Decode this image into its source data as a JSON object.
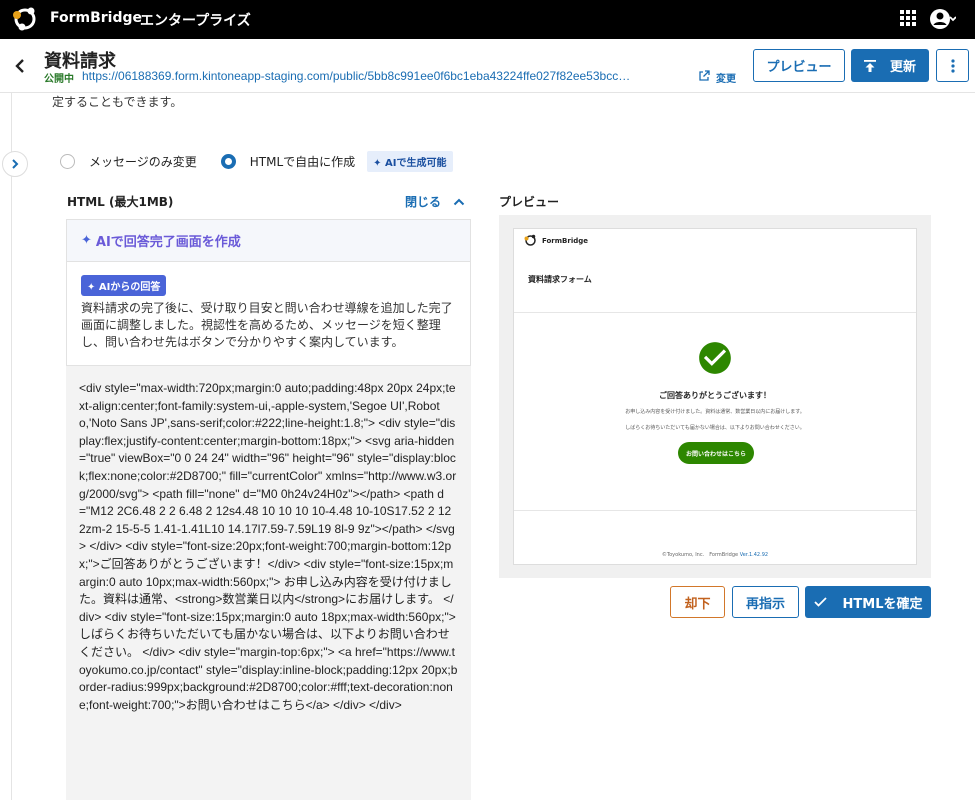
{
  "topbar": {
    "brand": "FormBridge",
    "edition": "エンタープライズ",
    "icons": [
      "logo-icon",
      "apps-grid-icon",
      "user-account-icon"
    ]
  },
  "header": {
    "title": "資料請求",
    "status": "公開中",
    "url": "https://06188369.form.kintoneapp-staging.com/public/5bb8c991ee0f6bc1eba43224ffe027f82ee53bcc…",
    "change": "変更",
    "preview_button": "プレビュー",
    "update_button": "更新"
  },
  "intro_text": "定することもできます。",
  "mode": {
    "option_message": "メッセージのみ変更",
    "option_html": "HTMLで自由に作成",
    "selected": "html",
    "ai_badge": "AIで生成可能"
  },
  "editor": {
    "label": "HTML (最大1MB)",
    "close": "閉じる",
    "ai_header": "AIで回答完了画面を作成",
    "ai_answer_badge": "AIからの回答",
    "ai_answer": "資料請求の完了後に、受け取り目安と問い合わせ導線を追加した完了画面に調整しました。視認性を高めるため、メッセージを短く整理し、問い合わせ先はボタンで分かりやすく案内しています。",
    "code": "<div style=\"max-width:720px;margin:0 auto;padding:48px 20px 24px;text-align:center;font-family:system-ui,-apple-system,'Segoe UI',Roboto,'Noto Sans JP',sans-serif;color:#222;line-height:1.8;\"> <div style=\"display:flex;justify-content:center;margin-bottom:18px;\"> <svg aria-hidden=\"true\" viewBox=\"0 0 24 24\" width=\"96\" height=\"96\" style=\"display:block;flex:none;color:#2D8700;\" fill=\"currentColor\" xmlns=\"http://www.w3.org/2000/svg\"> <path fill=\"none\" d=\"M0 0h24v24H0z\"></path> <path d=\"M12 2C6.48 2 2 6.48 2 12s4.48 10 10 10 10-4.48 10-10S17.52 2 12 2zm-2 15-5-5 1.41-1.41L10 14.17l7.59-7.59L19 8l-9 9z\"></path> </svg> </div> <div style=\"font-size:20px;font-weight:700;margin-bottom:12px;\">ご回答ありがとうございます！</div> <div style=\"font-size:15px;margin:0 auto 10px;max-width:560px;\"> お申し込み内容を受け付けました。資料は通常、<strong>数営業日以内</strong>にお届けします。 </div> <div style=\"font-size:15px;margin:0 auto 18px;max-width:560px;\"> しばらくお待ちいただいても届かない場合は、以下よりお問い合わせください。 </div> <div style=\"margin-top:6px;\"> <a href=\"https://www.toyokumo.co.jp/contact\" style=\"display:inline-block;padding:12px 20px;border-radius:999px;background:#2D8700;color:#fff;text-decoration:none;font-weight:700;\">お問い合わせはこちら</a> </div> </div>"
  },
  "preview": {
    "label": "プレビュー",
    "brand": "FormBridge",
    "form_title": "資料請求フォーム",
    "thanks": "ご回答ありがとうございます！",
    "line1": "お申し込み内容を受け付けました。資料は通常、数営業日以内にお届けします。",
    "line2": "しばらくお待ちいただいても届かない場合は、以下よりお問い合わせください。",
    "contact_button": "お問い合わせはこちら",
    "footer": "©Toyokumo, Inc.　FormBridge",
    "version": "Ver.1.42.92",
    "check_color": "#2D8700"
  },
  "actions": {
    "reject": "却下",
    "reinstruct": "再指示",
    "confirm": "HTMLを確定"
  },
  "colors": {
    "primary": "#1a6db3",
    "reject": "#c2621f",
    "success": "#2D8700"
  }
}
